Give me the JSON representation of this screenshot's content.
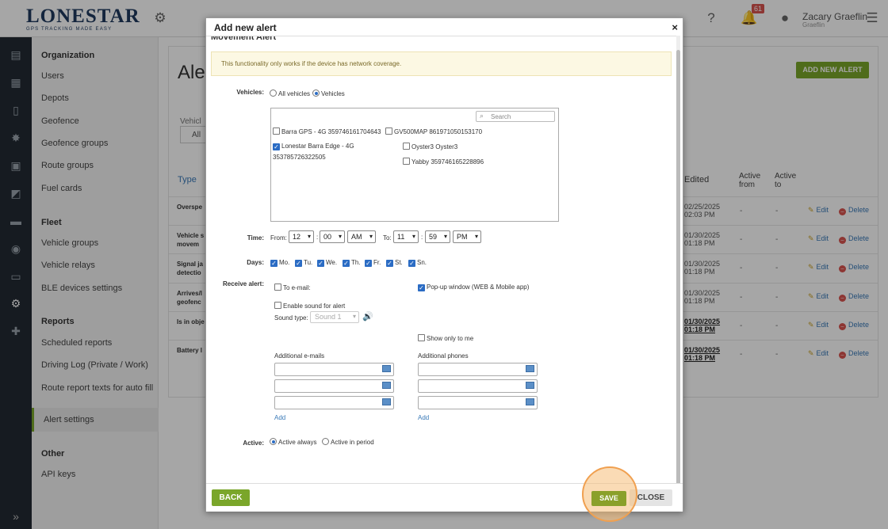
{
  "app": {
    "logo_main": "LONESTAR",
    "logo_sub": "GPS TRACKING MADE EASY",
    "notification_count": "61",
    "user_name": "Zacary Graeflin",
    "user_sub": "Graeflin"
  },
  "sidebar": {
    "sections": [
      {
        "title": "Organization",
        "items": [
          "Users",
          "Depots",
          "Geofence",
          "Geofence groups",
          "Route groups",
          "Fuel cards"
        ]
      },
      {
        "title": "Fleet",
        "items": [
          "Vehicle groups",
          "Vehicle relays",
          "BLE devices settings"
        ]
      },
      {
        "title": "Reports",
        "items": [
          "Scheduled reports",
          "Driving Log (Private / Work)",
          "Route report texts for auto fill",
          "Alert settings"
        ]
      },
      {
        "title": "Other",
        "items": [
          "API keys"
        ]
      }
    ],
    "active_item": "Alert settings"
  },
  "page": {
    "title": "Ale",
    "add_button": "ADD NEW ALERT",
    "vehicle_filter_label": "Vehicl",
    "vehicle_filter_value": "All",
    "columns": {
      "type": "Type",
      "edited": "Edited",
      "active_from": "Active from",
      "active_to": "Active to"
    },
    "rows": [
      {
        "type": "Overspe",
        "edited": "02/25/2025 02:03 PM",
        "bold": false
      },
      {
        "type": "Vehicle s movem",
        "edited": "01/30/2025 01:18 PM",
        "bold": false
      },
      {
        "type": "Signal ja detectio",
        "edited": "01/30/2025 01:18 PM",
        "bold": false
      },
      {
        "type": "Arrives/l geofenc",
        "edited": "01/30/2025 01:18 PM",
        "bold": false
      },
      {
        "type": "Is in obje",
        "edited": "01/30/2025 01:18 PM",
        "bold": true
      },
      {
        "type": "Battery l",
        "edited": "01/30/2025 01:18 PM",
        "bold": true
      }
    ],
    "dash": "-",
    "edit_label": "Edit",
    "delete_label": "Delete"
  },
  "modal": {
    "title": "Add new alert",
    "close_x": "×",
    "section_title": "Movement Alert",
    "notice": "This functionality only works if the device has network coverage.",
    "vehicles_label": "Vehicles:",
    "all_vehicles": "All vehicles",
    "vehicles_option": "Vehicles",
    "search_placeholder": "Search",
    "vehicle_list": [
      {
        "name": "Barra GPS - 4G 359746161704643",
        "checked": false
      },
      {
        "name": "GV500MAP 861971050153170",
        "checked": false
      },
      {
        "name": "Lonestar Barra Edge - 4G",
        "name2": "353785726322505",
        "checked": true
      },
      {
        "name": "Oyster3 Oyster3",
        "checked": false
      },
      {
        "name": "Yabby 359746165228896",
        "checked": false
      }
    ],
    "time_label": "Time:",
    "from_label": "From:",
    "to_label": "To:",
    "from_hour": "12",
    "from_min": "00",
    "from_ampm": "AM",
    "to_hour": "11",
    "to_min": "59",
    "to_ampm": "PM",
    "colon": ":",
    "days_label": "Days:",
    "days": [
      "Mo.",
      "Tu.",
      "We.",
      "Th.",
      "Fr.",
      "St.",
      "Sn."
    ],
    "receive_label": "Receive alert:",
    "to_email": "To e-mail:",
    "popup_window": "Pop-up window (WEB & Mobile app)",
    "enable_sound": "Enable sound for alert",
    "sound_type_label": "Sound type:",
    "sound_type_value": "Sound 1",
    "show_only_me": "Show only to me",
    "additional_emails": "Additional e-mails",
    "additional_phones": "Additional phones",
    "add_link": "Add",
    "active_label": "Active:",
    "active_always": "Active always",
    "active_period": "Active in period",
    "back_button": "BACK",
    "save_button": "SAVE",
    "close_button": "CLOSE"
  },
  "colors": {
    "accent": "#7aa62a",
    "link": "#3a7ab8",
    "danger": "#d9534f",
    "notice_bg": "#fcf8e3"
  }
}
